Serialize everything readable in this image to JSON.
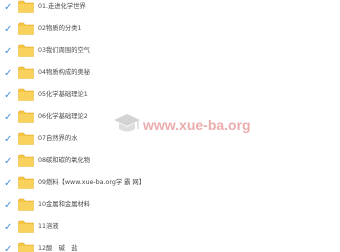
{
  "colors": {
    "checkmark": "#4a90d9",
    "folder": "#f5c542",
    "text": "#4a4a4a",
    "watermark": "#e08080"
  },
  "folders": [
    {
      "name": "01.走进化学世界",
      "checked": true,
      "icon": "folder-icon"
    },
    {
      "name": "02物质的分类1",
      "checked": true,
      "icon": "folder-icon"
    },
    {
      "name": "03我们周围的空气",
      "checked": true,
      "icon": "folder-icon"
    },
    {
      "name": "04物质构成的奥秘",
      "checked": true,
      "icon": "folder-icon"
    },
    {
      "name": "05化学基础理论1",
      "checked": true,
      "icon": "folder-icon"
    },
    {
      "name": "06化学基础理论2",
      "checked": true,
      "icon": "folder-icon"
    },
    {
      "name": "07自然界的水",
      "checked": true,
      "icon": "folder-icon"
    },
    {
      "name": "08碳和碳的氧化物",
      "checked": true,
      "icon": "folder-icon"
    },
    {
      "name": "09燃料【www.xue-ba.org学 霸 网】",
      "checked": true,
      "icon": "folder-icon"
    },
    {
      "name": "10金属和金属材料",
      "checked": true,
      "icon": "folder-icon"
    },
    {
      "name": "11溶液",
      "checked": true,
      "icon": "folder-icon"
    },
    {
      "name": "12酸　碱　盐",
      "checked": true,
      "icon": "folder-icon"
    }
  ],
  "watermark": {
    "text": "www.xue-ba.org",
    "icon": "graduation-cap-icon"
  }
}
